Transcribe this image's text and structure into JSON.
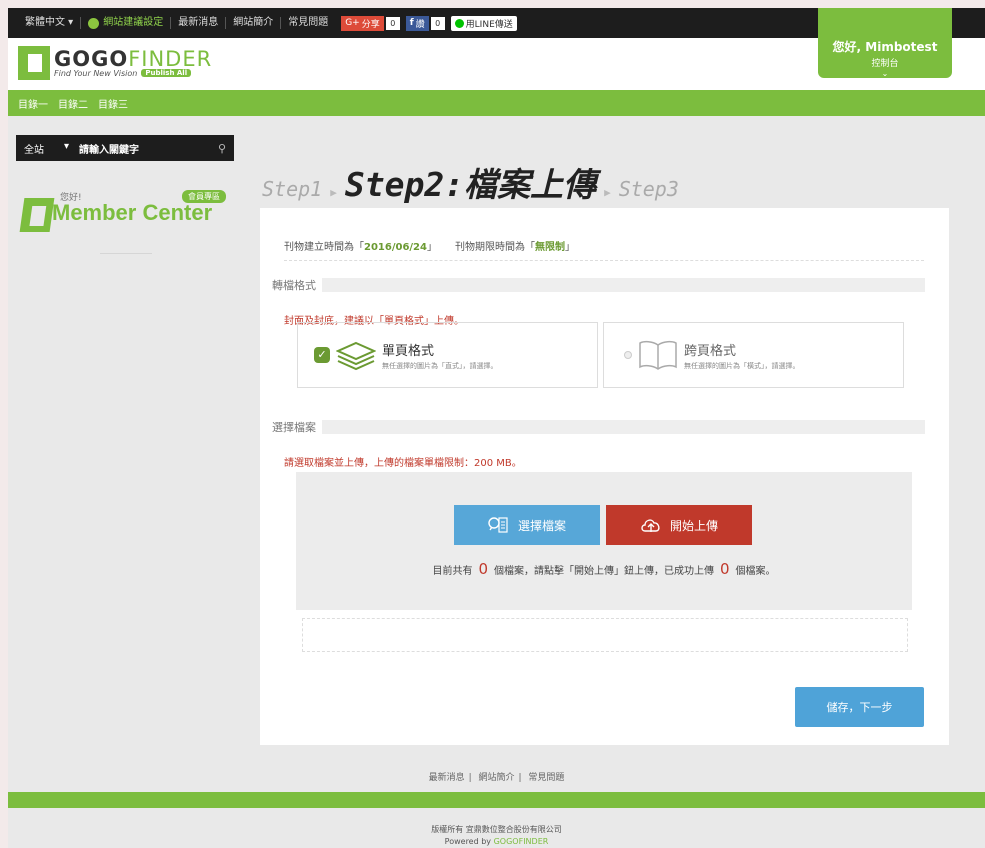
{
  "topbar": {
    "language": "繁體中文",
    "site_settings": "網站建議設定",
    "news": "最新消息",
    "about": "網站簡介",
    "faq": "常見問題",
    "share": {
      "gplus_label": "分享",
      "gplus_count": "0",
      "fb_label": "讚",
      "fb_count": "0",
      "line_label": "用LINE傳送"
    }
  },
  "logo": {
    "name_main": "GOGO",
    "name_accent": "FINDER",
    "tagline": "Find Your New Vision",
    "publish_badge": "Publish All"
  },
  "user": {
    "greeting": "您好, Mimbotest",
    "console": "控制台",
    "chevron": "⌄"
  },
  "nav": [
    "目錄一",
    "目錄二",
    "目錄三"
  ],
  "sidebar": {
    "search_scope": "全站",
    "search_placeholder": "請輸入關鍵字",
    "member_hi": "您好!",
    "member_badge": "會員專區",
    "member_title": "Member Center"
  },
  "steps": {
    "step1": "Step1",
    "step2": "Step2:檔案上傳",
    "step3": "Step3"
  },
  "panel": {
    "created_label": "刊物建立時間為「",
    "created_value": "2016/06/24",
    "created_close": "」",
    "expire_label": "刊物期限時間為「",
    "expire_value": "無限制",
    "expire_close": "」",
    "convert_title": "轉檔格式",
    "convert_note": "封面及封底，建議以「單頁格式」上傳。",
    "option_single_title": "單頁格式",
    "option_single_desc": "無任選擇的圖片為「直式」，請選擇。",
    "option_spread_title": "跨頁格式",
    "option_spread_desc": "無任選擇的圖片為「橫式」，請選擇。",
    "file_title": "選擇檔案",
    "file_note": "請選取檔案並上傳，上傳的檔案單檔限制：200 MB。",
    "choose_button": "選擇檔案",
    "upload_button": "開始上傳",
    "count_prefix": "目前共有",
    "count_total": "0",
    "count_middle": "個檔案，請點擊「開始上傳」鈕上傳，已成功上傳",
    "count_done": "0",
    "count_suffix": "個檔案。",
    "next_button": "儲存，下一步"
  },
  "footer": {
    "links": [
      "最新消息",
      "網站簡介",
      "常見問題"
    ],
    "copyright": "版權所有 宜鼎數位整合股份有限公司",
    "powered_prefix": "Powered by ",
    "powered_brand": "GOGOFINDER"
  },
  "colors": {
    "brand_green": "#7cbd3e",
    "dark_bar": "#1d1d1d",
    "choose_blue": "#57a7d8",
    "upload_red": "#c0392b",
    "next_blue": "#4fa3d8"
  }
}
